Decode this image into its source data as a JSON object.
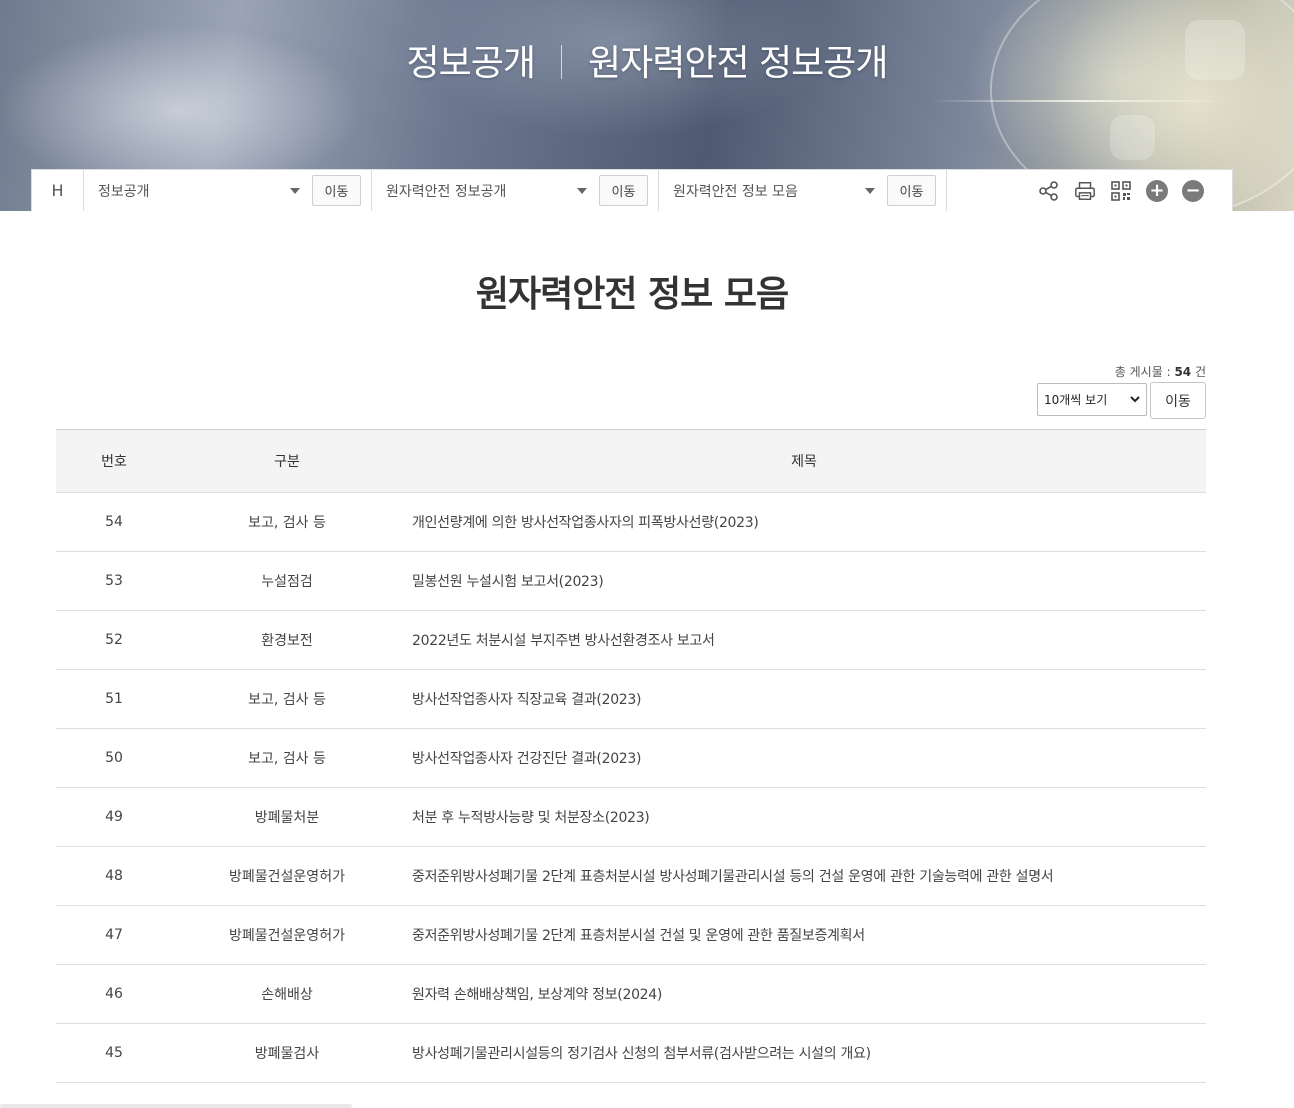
{
  "hero": {
    "title_left": "정보공개",
    "title_right": "원자력안전 정보공개"
  },
  "location": {
    "home_label": "H",
    "level1": "정보공개",
    "level2": "원자력안전 정보공개",
    "level3": "원자력안전 정보 모음",
    "go_label": "이동",
    "tools": [
      "share-icon",
      "print-icon",
      "qr-code-icon",
      "zoom-in-icon",
      "zoom-out-icon"
    ]
  },
  "page": {
    "title": "원자력안전 정보 모음",
    "total_prefix": "총 게시물 : ",
    "total_count": "54",
    "total_suffix": " 건",
    "per_page_selected": "10개씩 보기",
    "per_page_go": "이동"
  },
  "table": {
    "headers": [
      "번호",
      "구분",
      "제목"
    ],
    "rows": [
      {
        "no": "54",
        "category": "보고, 검사 등",
        "title": "개인선량계에 의한 방사선작업종사자의 피폭방사선량(2023)"
      },
      {
        "no": "53",
        "category": "누설점검",
        "title": "밀봉선원 누설시험 보고서(2023)"
      },
      {
        "no": "52",
        "category": "환경보전",
        "title": "2022년도 처분시설 부지주변 방사선환경조사 보고서"
      },
      {
        "no": "51",
        "category": "보고, 검사 등",
        "title": "방사선작업종사자 직장교육 결과(2023)"
      },
      {
        "no": "50",
        "category": "보고, 검사 등",
        "title": "방사선작업종사자 건강진단 결과(2023)"
      },
      {
        "no": "49",
        "category": "방폐물처분",
        "title": "처분 후 누적방사능량 및 처분장소(2023)"
      },
      {
        "no": "48",
        "category": "방폐물건설운영허가",
        "title": "중저준위방사성폐기물 2단계 표층처분시설 방사성폐기물관리시설 등의 건설 운영에 관한 기술능력에 관한 설명서"
      },
      {
        "no": "47",
        "category": "방폐물건설운영허가",
        "title": "중저준위방사성폐기물 2단계 표층처분시설 건설 및 운영에 관한 품질보증계획서"
      },
      {
        "no": "46",
        "category": "손해배상",
        "title": "원자력 손해배상책임, 보상계약 정보(2024)"
      },
      {
        "no": "45",
        "category": "방폐물검사",
        "title": "방사성폐기물관리시설등의 정기검사 신청의 첨부서류(검사받으려는 시설의 개요)"
      }
    ]
  }
}
